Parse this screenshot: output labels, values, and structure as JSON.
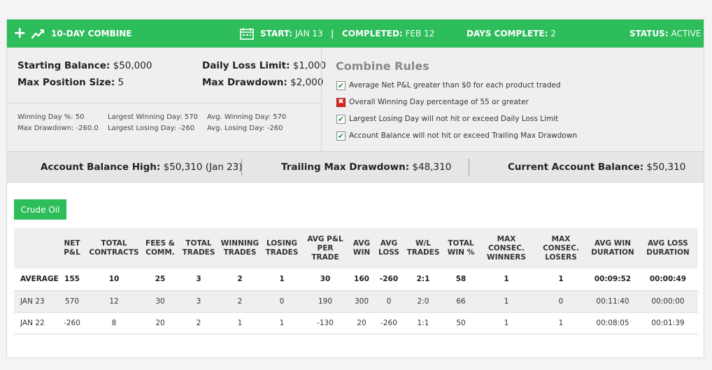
{
  "header": {
    "plus_icon": "+",
    "title": "10-DAY COMBINE",
    "start_label": "START:",
    "start_value": "JAN 13",
    "separator": "|",
    "completed_label": "COMPLETED:",
    "completed_value": "FEB 12",
    "days_label": "DAYS COMPLETE:",
    "days_value": "2",
    "status_label": "STATUS:",
    "status_value": "ACTIVE"
  },
  "account": {
    "starting_balance_label": "Starting Balance:",
    "starting_balance_value": "$50,000",
    "max_position_label": "Max Position Size:",
    "max_position_value": "5",
    "daily_loss_label": "Daily Loss Limit:",
    "daily_loss_value": "$1,000",
    "max_drawdown_label": "Max Drawdown:",
    "max_drawdown_value": "$2,000"
  },
  "small_stats": {
    "winning_day_pct": "Winning Day %: 50",
    "max_drawdown": "Max Drawdown: -260.0",
    "largest_winning_day": "Largest Winning Day: 570",
    "largest_losing_day": "Largest Losing Day: -260",
    "avg_winning_day": "Avg. Winning Day: 570",
    "avg_losing_day": "Avg. Losing Day: -260"
  },
  "rules": {
    "title": "Combine Rules",
    "items": [
      {
        "text": "Average Net P&L greater than $0 for each product traded",
        "passed": true,
        "mark": "✔"
      },
      {
        "text": "Overall Winning Day percentage of 55 or greater",
        "passed": false,
        "mark": "✖"
      },
      {
        "text": "Largest Losing Day will not hit or exceed Daily Loss Limit",
        "passed": true,
        "mark": "✔"
      },
      {
        "text": "Account Balance will not hit or exceed Trailing Max Drawdown",
        "passed": true,
        "mark": "✔"
      }
    ]
  },
  "balances": {
    "high_label": "Account Balance High:",
    "high_value": "$50,310 (Jan 23)",
    "trailing_label": "Trailing Max Drawdown:",
    "trailing_value": "$48,310",
    "current_label": "Current Account Balance:",
    "current_value": "$50,310"
  },
  "product_button": "Crude Oil",
  "table": {
    "columns": [
      "",
      "NET\nP&L",
      "TOTAL\nCONTRACTS",
      "FEES &\nCOMM.",
      "TOTAL\nTRADES",
      "WINNING\nTRADES",
      "LOSING\nTRADES",
      "AVG P&L\nPER TRADE",
      "AVG\nWIN",
      "AVG\nLOSS",
      "W/L\nTRADES",
      "TOTAL\nWIN %",
      "MAX\nCONSEC.\nWINNERS",
      "MAX\nCONSEC.\nLOSERS",
      "AVG WIN\nDURATION",
      "AVG LOSS\nDURATION"
    ],
    "rows": [
      [
        "AVERAGE",
        "155",
        "10",
        "25",
        "3",
        "2",
        "1",
        "30",
        "160",
        "-260",
        "2:1",
        "58",
        "1",
        "1",
        "00:09:52",
        "00:00:49"
      ],
      [
        "JAN 23",
        "570",
        "12",
        "30",
        "3",
        "2",
        "0",
        "190",
        "300",
        "0",
        "2:0",
        "66",
        "1",
        "0",
        "00:11:40",
        "00:00:00"
      ],
      [
        "JAN 22",
        "-260",
        "8",
        "20",
        "2",
        "1",
        "1",
        "-130",
        "20",
        "-260",
        "1:1",
        "50",
        "1",
        "1",
        "00:08:05",
        "00:01:39"
      ]
    ]
  },
  "colors": {
    "accent_green": "#2dbd5b",
    "fail_red": "#d62a2a"
  }
}
